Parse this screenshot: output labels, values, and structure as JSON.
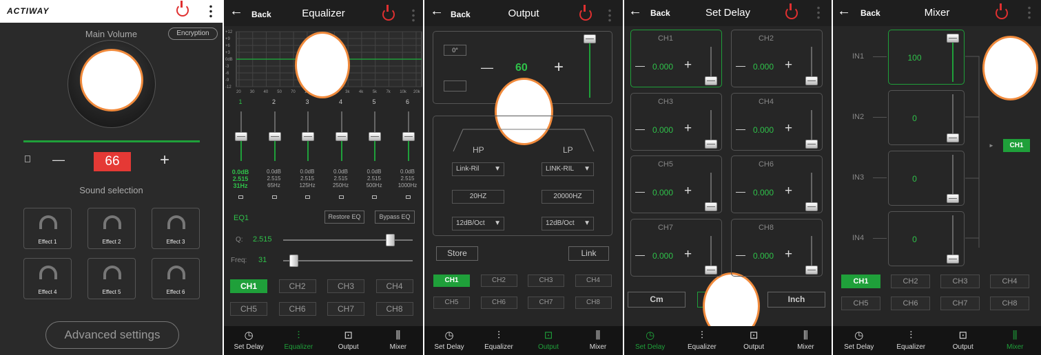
{
  "main": {
    "logo": "ACTIWAY",
    "title": "Main Volume",
    "encryption": "Encryption",
    "volume": "66",
    "minus": "—",
    "plus": "+",
    "sound_selection": "Sound selection",
    "effects": [
      "Effect 1",
      "Effect 2",
      "Effect 3",
      "Effect 4",
      "Effect 5",
      "Effect 6"
    ],
    "advanced": "Advanced settings"
  },
  "equalizer": {
    "back": "Back",
    "title": "Equalizer",
    "y_labels": [
      "+12",
      "+9",
      "+6",
      "+3",
      "0dB",
      "-3",
      "-6",
      "-9",
      "-12"
    ],
    "x_labels": [
      "20",
      "30",
      "40",
      "50",
      "70",
      "100",
      "200",
      "2k",
      "3k",
      "4k",
      "5k",
      "7k",
      "10k",
      "20k"
    ],
    "bands": [
      {
        "num": "1",
        "gain": "0.0dB",
        "q": "2.515",
        "freq": "31Hz",
        "level": 0.5,
        "active": true
      },
      {
        "num": "2",
        "gain": "0.0dB",
        "q": "2.515",
        "freq": "65Hz",
        "level": 0.5,
        "active": false
      },
      {
        "num": "3",
        "gain": "0.0dB",
        "q": "2.515",
        "freq": "125Hz",
        "level": 0.5,
        "active": false
      },
      {
        "num": "4",
        "gain": "0.0dB",
        "q": "2.515",
        "freq": "250Hz",
        "level": 0.5,
        "active": false
      },
      {
        "num": "5",
        "gain": "0.0dB",
        "q": "2.515",
        "freq": "500Hz",
        "level": 0.5,
        "active": false
      },
      {
        "num": "6",
        "gain": "0.0dB",
        "q": "2.515",
        "freq": "1000Hz",
        "level": 0.5,
        "active": false
      }
    ],
    "eq_label": "EQ1",
    "restore": "Restore EQ",
    "bypass": "Bypass EQ",
    "q_label": "Q:",
    "q_value": "2.515",
    "q_level": 0.85,
    "freq_label": "Freq:",
    "freq_value": "31",
    "freq_level": 0.05
  },
  "output": {
    "back": "Back",
    "title": "Output",
    "phase": "0°",
    "value": "60",
    "minus": "—",
    "plus": "+",
    "level": 1.0,
    "hp": "HP",
    "lp": "LP",
    "hp_type": "Link-Ril",
    "lp_type": "LINK-RIL",
    "hp_freq": "20HZ",
    "lp_freq": "20000HZ",
    "hp_slope": "12dB/Oct",
    "lp_slope": "12dB/Oct",
    "store": "Store",
    "link": "Link"
  },
  "delay": {
    "back": "Back",
    "title": "Set Delay",
    "channels": [
      {
        "name": "CH1",
        "value": "0.000"
      },
      {
        "name": "CH2",
        "value": "0.000"
      },
      {
        "name": "CH3",
        "value": "0.000"
      },
      {
        "name": "CH4",
        "value": "0.000"
      },
      {
        "name": "CH5",
        "value": "0.000"
      },
      {
        "name": "CH6",
        "value": "0.000"
      },
      {
        "name": "CH7",
        "value": "0.000"
      },
      {
        "name": "CH8",
        "value": "0.000"
      }
    ],
    "minus": "—",
    "plus": "+",
    "cm": "Cm",
    "inch": "Inch"
  },
  "mixer": {
    "back": "Back",
    "title": "Mixer",
    "inputs": [
      {
        "name": "IN1",
        "value": "100",
        "level": 1.0
      },
      {
        "name": "IN2",
        "value": "0",
        "level": 0.0
      },
      {
        "name": "IN3",
        "value": "0",
        "level": 0.0
      },
      {
        "name": "IN4",
        "value": "0",
        "level": 0.0
      }
    ],
    "target": "CH1"
  },
  "channels": [
    "CH1",
    "CH2",
    "CH3",
    "CH4",
    "CH5",
    "CH6",
    "CH7",
    "CH8"
  ],
  "tabs": [
    {
      "label": "Set Delay",
      "icon": "clock-icon"
    },
    {
      "label": "Equalizer",
      "icon": "sliders-icon"
    },
    {
      "label": "Output",
      "icon": "waveform-box-icon"
    },
    {
      "label": "Mixer",
      "icon": "audio-wave-icon"
    }
  ],
  "colors": {
    "accent": "#1fa03a",
    "power": "#e03030",
    "volume_box": "#e53935",
    "annotation": "#f08a3c"
  }
}
